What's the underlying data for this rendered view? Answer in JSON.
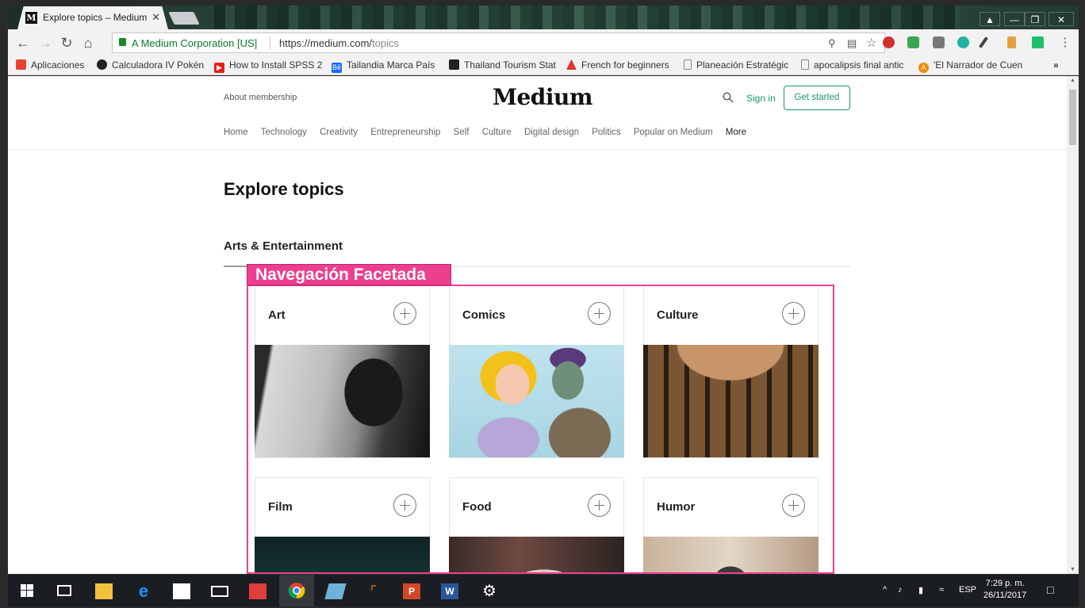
{
  "browser": {
    "tab_title": "Explore topics – Medium",
    "tab_favicon": "M",
    "org_name": "A Medium Corporation [US]",
    "url_prefix": "https://medium.com/",
    "url_path": "topics"
  },
  "bookmarks": [
    {
      "label": "Aplicaciones",
      "icon": "apps-grid-icon",
      "color": "#e94235"
    },
    {
      "label": "Calculadora IV Pokén",
      "icon": "power-icon",
      "color": "#222"
    },
    {
      "label": "How to Install SPSS 2",
      "icon": "youtube-icon",
      "color": "#e62117"
    },
    {
      "label": "Tailandia Marca País",
      "icon": "behance-icon",
      "color": "#1769ff"
    },
    {
      "label": "Thailand Tourism Stat",
      "icon": "sheet-icon",
      "color": "#222"
    },
    {
      "label": "French for beginners",
      "icon": "triangle-logo-icon",
      "color": "#d33"
    },
    {
      "label": "Planeación Estratégic",
      "icon": "page-icon",
      "color": "#888"
    },
    {
      "label": "apocalipsis final antic",
      "icon": "page-icon",
      "color": "#888"
    },
    {
      "label": "'El Narrador de Cuen",
      "icon": "avast-icon",
      "color": "#f08a00"
    }
  ],
  "header": {
    "about": "About membership",
    "logo": "Medium",
    "signin": "Sign in",
    "get_started": "Get started"
  },
  "nav": [
    "Home",
    "Technology",
    "Creativity",
    "Entrepreneurship",
    "Self",
    "Culture",
    "Digital design",
    "Politics",
    "Popular on Medium",
    "More"
  ],
  "main": {
    "title": "Explore topics",
    "section": "Arts & Entertainment",
    "annotation": "Navegación Facetada"
  },
  "cards": [
    {
      "name": "Art"
    },
    {
      "name": "Comics"
    },
    {
      "name": "Culture"
    },
    {
      "name": "Film"
    },
    {
      "name": "Food"
    },
    {
      "name": "Humor"
    }
  ],
  "taskbar": {
    "language": "ESP",
    "time": "7:29 p. m.",
    "date": "26/11/2017"
  },
  "colors": {
    "medium_green": "#1c9963",
    "annotation_pink": "#ec3f8f"
  }
}
